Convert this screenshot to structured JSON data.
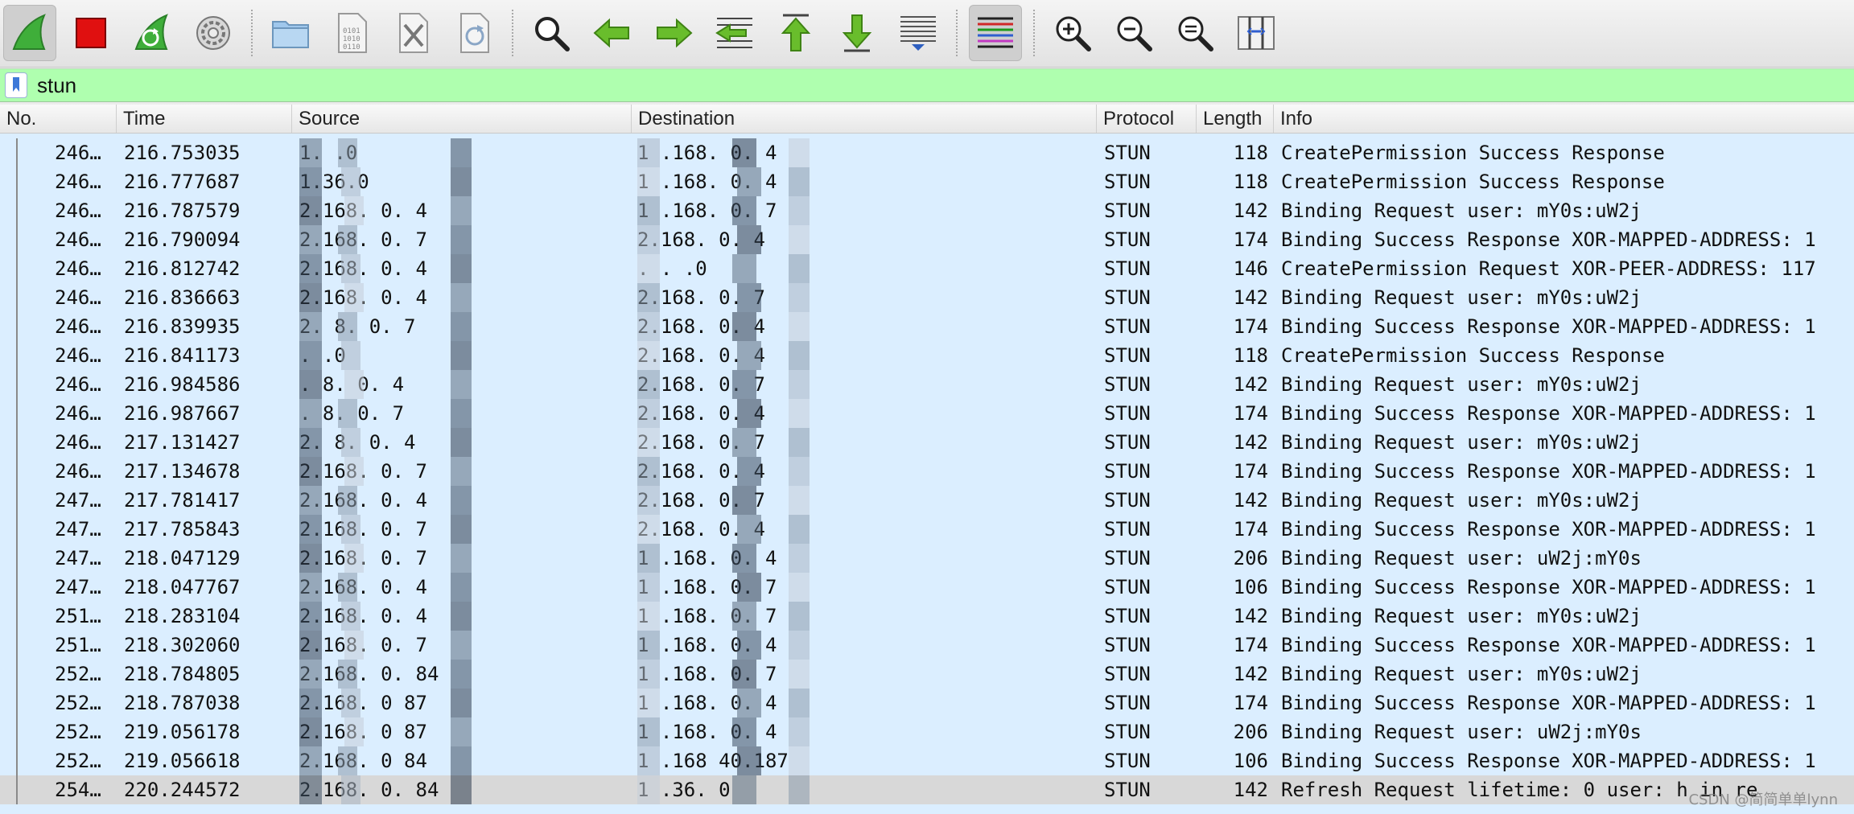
{
  "toolbar": {
    "buttons": [
      {
        "name": "start-capture-button",
        "icon": "shark-fin-icon"
      },
      {
        "name": "stop-capture-button",
        "icon": "red-square-icon"
      },
      {
        "name": "restart-capture-button",
        "icon": "restart-shark-icon"
      },
      {
        "name": "capture-options-button",
        "icon": "gear-icon"
      },
      {
        "name": "open-file-button",
        "icon": "folder-icon"
      },
      {
        "name": "save-file-button",
        "icon": "binary-file-icon"
      },
      {
        "name": "close-file-button",
        "icon": "close-file-icon"
      },
      {
        "name": "reload-file-button",
        "icon": "reload-file-icon"
      },
      {
        "name": "find-packet-button",
        "icon": "magnifier-icon"
      },
      {
        "name": "go-back-button",
        "icon": "arrow-left-icon"
      },
      {
        "name": "go-forward-button",
        "icon": "arrow-right-icon"
      },
      {
        "name": "go-to-packet-button",
        "icon": "goto-packet-icon"
      },
      {
        "name": "first-packet-button",
        "icon": "arrow-top-icon"
      },
      {
        "name": "last-packet-button",
        "icon": "arrow-bottom-icon"
      },
      {
        "name": "autoscroll-button",
        "icon": "autoscroll-icon"
      },
      {
        "name": "colorize-button",
        "icon": "colorize-lines-icon"
      },
      {
        "name": "zoom-in-button",
        "icon": "zoom-in-icon"
      },
      {
        "name": "zoom-out-button",
        "icon": "zoom-out-icon"
      },
      {
        "name": "normal-size-button",
        "icon": "zoom-normal-icon"
      },
      {
        "name": "resize-columns-button",
        "icon": "resize-columns-icon"
      }
    ]
  },
  "filter": {
    "value": "stun"
  },
  "columns": [
    "No.",
    "Time",
    "Source",
    "Destination",
    "Protocol",
    "Length",
    "Info"
  ],
  "packets": [
    {
      "no": "246…",
      "time": "216.753035",
      "src": "  1.  .0",
      "dst": "1  .168.  0.  4",
      "proto": "STUN",
      "len": "118",
      "info": "CreatePermission Success Response"
    },
    {
      "no": "246…",
      "time": "216.777687",
      "src": "  1.36.0",
      "dst": "1  .168.  0.  4",
      "proto": "STUN",
      "len": "118",
      "info": "CreatePermission Success Response"
    },
    {
      "no": "246…",
      "time": "216.787579",
      "src": "  2.168.  0.  4",
      "dst": "1  .168.  0.  7",
      "proto": "STUN",
      "len": "142",
      "info": "Binding Request user: mY0s:uW2j"
    },
    {
      "no": "246…",
      "time": "216.790094",
      "src": "  2.168.  0.  7",
      "dst": "  2.168.  0.  4",
      "proto": "STUN",
      "len": "174",
      "info": "Binding Success Response XOR-MAPPED-ADDRESS: 1"
    },
    {
      "no": "246…",
      "time": "216.812742",
      "src": "  2.168.  0.  4",
      "dst": "   .  .  .0",
      "proto": "STUN",
      "len": "146",
      "info": "CreatePermission Request XOR-PEER-ADDRESS: 117"
    },
    {
      "no": "246…",
      "time": "216.836663",
      "src": "  2.168.  0.  4",
      "dst": "  2.168.  0.  7",
      "proto": "STUN",
      "len": "142",
      "info": "Binding Request user: mY0s:uW2j"
    },
    {
      "no": "246…",
      "time": "216.839935",
      "src": "  2.  8.  0.  7",
      "dst": "  2.168.  0.  4",
      "proto": "STUN",
      "len": "174",
      "info": "Binding Success Response XOR-MAPPED-ADDRESS: 1"
    },
    {
      "no": "246…",
      "time": "216.841173",
      "src": "   .  .0",
      "dst": "  2.168.  0.  4",
      "proto": "STUN",
      "len": "118",
      "info": "CreatePermission Success Response"
    },
    {
      "no": "246…",
      "time": "216.984586",
      "src": "   .  8.  0.  4",
      "dst": "  2.168.  0.  7",
      "proto": "STUN",
      "len": "142",
      "info": "Binding Request user: mY0s:uW2j"
    },
    {
      "no": "246…",
      "time": "216.987667",
      "src": "   .  8.  0.  7",
      "dst": "  2.168.  0.  4",
      "proto": "STUN",
      "len": "174",
      "info": "Binding Success Response XOR-MAPPED-ADDRESS: 1"
    },
    {
      "no": "246…",
      "time": "217.131427",
      "src": "  2.  8.  0.  4",
      "dst": "  2.168.  0.  7",
      "proto": "STUN",
      "len": "142",
      "info": "Binding Request user: mY0s:uW2j"
    },
    {
      "no": "246…",
      "time": "217.134678",
      "src": "  2.168.  0.  7",
      "dst": "  2.168.  0.  4",
      "proto": "STUN",
      "len": "174",
      "info": "Binding Success Response XOR-MAPPED-ADDRESS: 1"
    },
    {
      "no": "247…",
      "time": "217.781417",
      "src": "  2.168.  0.  4",
      "dst": "  2.168.  0.  7",
      "proto": "STUN",
      "len": "142",
      "info": "Binding Request user: mY0s:uW2j"
    },
    {
      "no": "247…",
      "time": "217.785843",
      "src": "  2.168.  0.  7",
      "dst": "  2.168.  0.  4",
      "proto": "STUN",
      "len": "174",
      "info": "Binding Success Response XOR-MAPPED-ADDRESS: 1"
    },
    {
      "no": "247…",
      "time": "218.047129",
      "src": "  2.168.  0.  7",
      "dst": "1  .168.  0.  4",
      "proto": "STUN",
      "len": "206",
      "info": "Binding Request user: uW2j:mY0s"
    },
    {
      "no": "247…",
      "time": "218.047767",
      "src": "  2.168.  0.  4",
      "dst": "1  .168.  0.  7",
      "proto": "STUN",
      "len": "106",
      "info": "Binding Success Response XOR-MAPPED-ADDRESS: 1"
    },
    {
      "no": "251…",
      "time": "218.283104",
      "src": "  2.168.  0.  4",
      "dst": "1  .168.  0.  7",
      "proto": "STUN",
      "len": "142",
      "info": "Binding Request user: mY0s:uW2j"
    },
    {
      "no": "251…",
      "time": "218.302060",
      "src": "  2.168.  0.  7",
      "dst": "1  .168.  0.  4",
      "proto": "STUN",
      "len": "174",
      "info": "Binding Success Response XOR-MAPPED-ADDRESS: 1"
    },
    {
      "no": "252…",
      "time": "218.784805",
      "src": "  2.168.  0.  84",
      "dst": "1  .168.  0.  7",
      "proto": "STUN",
      "len": "142",
      "info": "Binding Request user: mY0s:uW2j"
    },
    {
      "no": "252…",
      "time": "218.787038",
      "src": "  2.168.  0  87",
      "dst": "1  .168.  0.  4",
      "proto": "STUN",
      "len": "174",
      "info": "Binding Success Response XOR-MAPPED-ADDRESS: 1"
    },
    {
      "no": "252…",
      "time": "219.056178",
      "src": "  2.168.  0  87",
      "dst": "1  .168.  0.  4",
      "proto": "STUN",
      "len": "206",
      "info": "Binding Request user: uW2j:mY0s"
    },
    {
      "no": "252…",
      "time": "219.056618",
      "src": "  2.168.  0  84",
      "dst": "1  .168  40.187",
      "proto": "STUN",
      "len": "106",
      "info": "Binding Success Response XOR-MAPPED-ADDRESS: 1"
    },
    {
      "no": "254…",
      "time": "220.244572",
      "src": "  2.168.  0.  84",
      "dst": "1  .36.  0",
      "proto": "STUN",
      "len": "142",
      "info": "Refresh Request lifetime: 0 user: h    in re"
    }
  ],
  "watermark": "CSDN @简简单单lynn"
}
